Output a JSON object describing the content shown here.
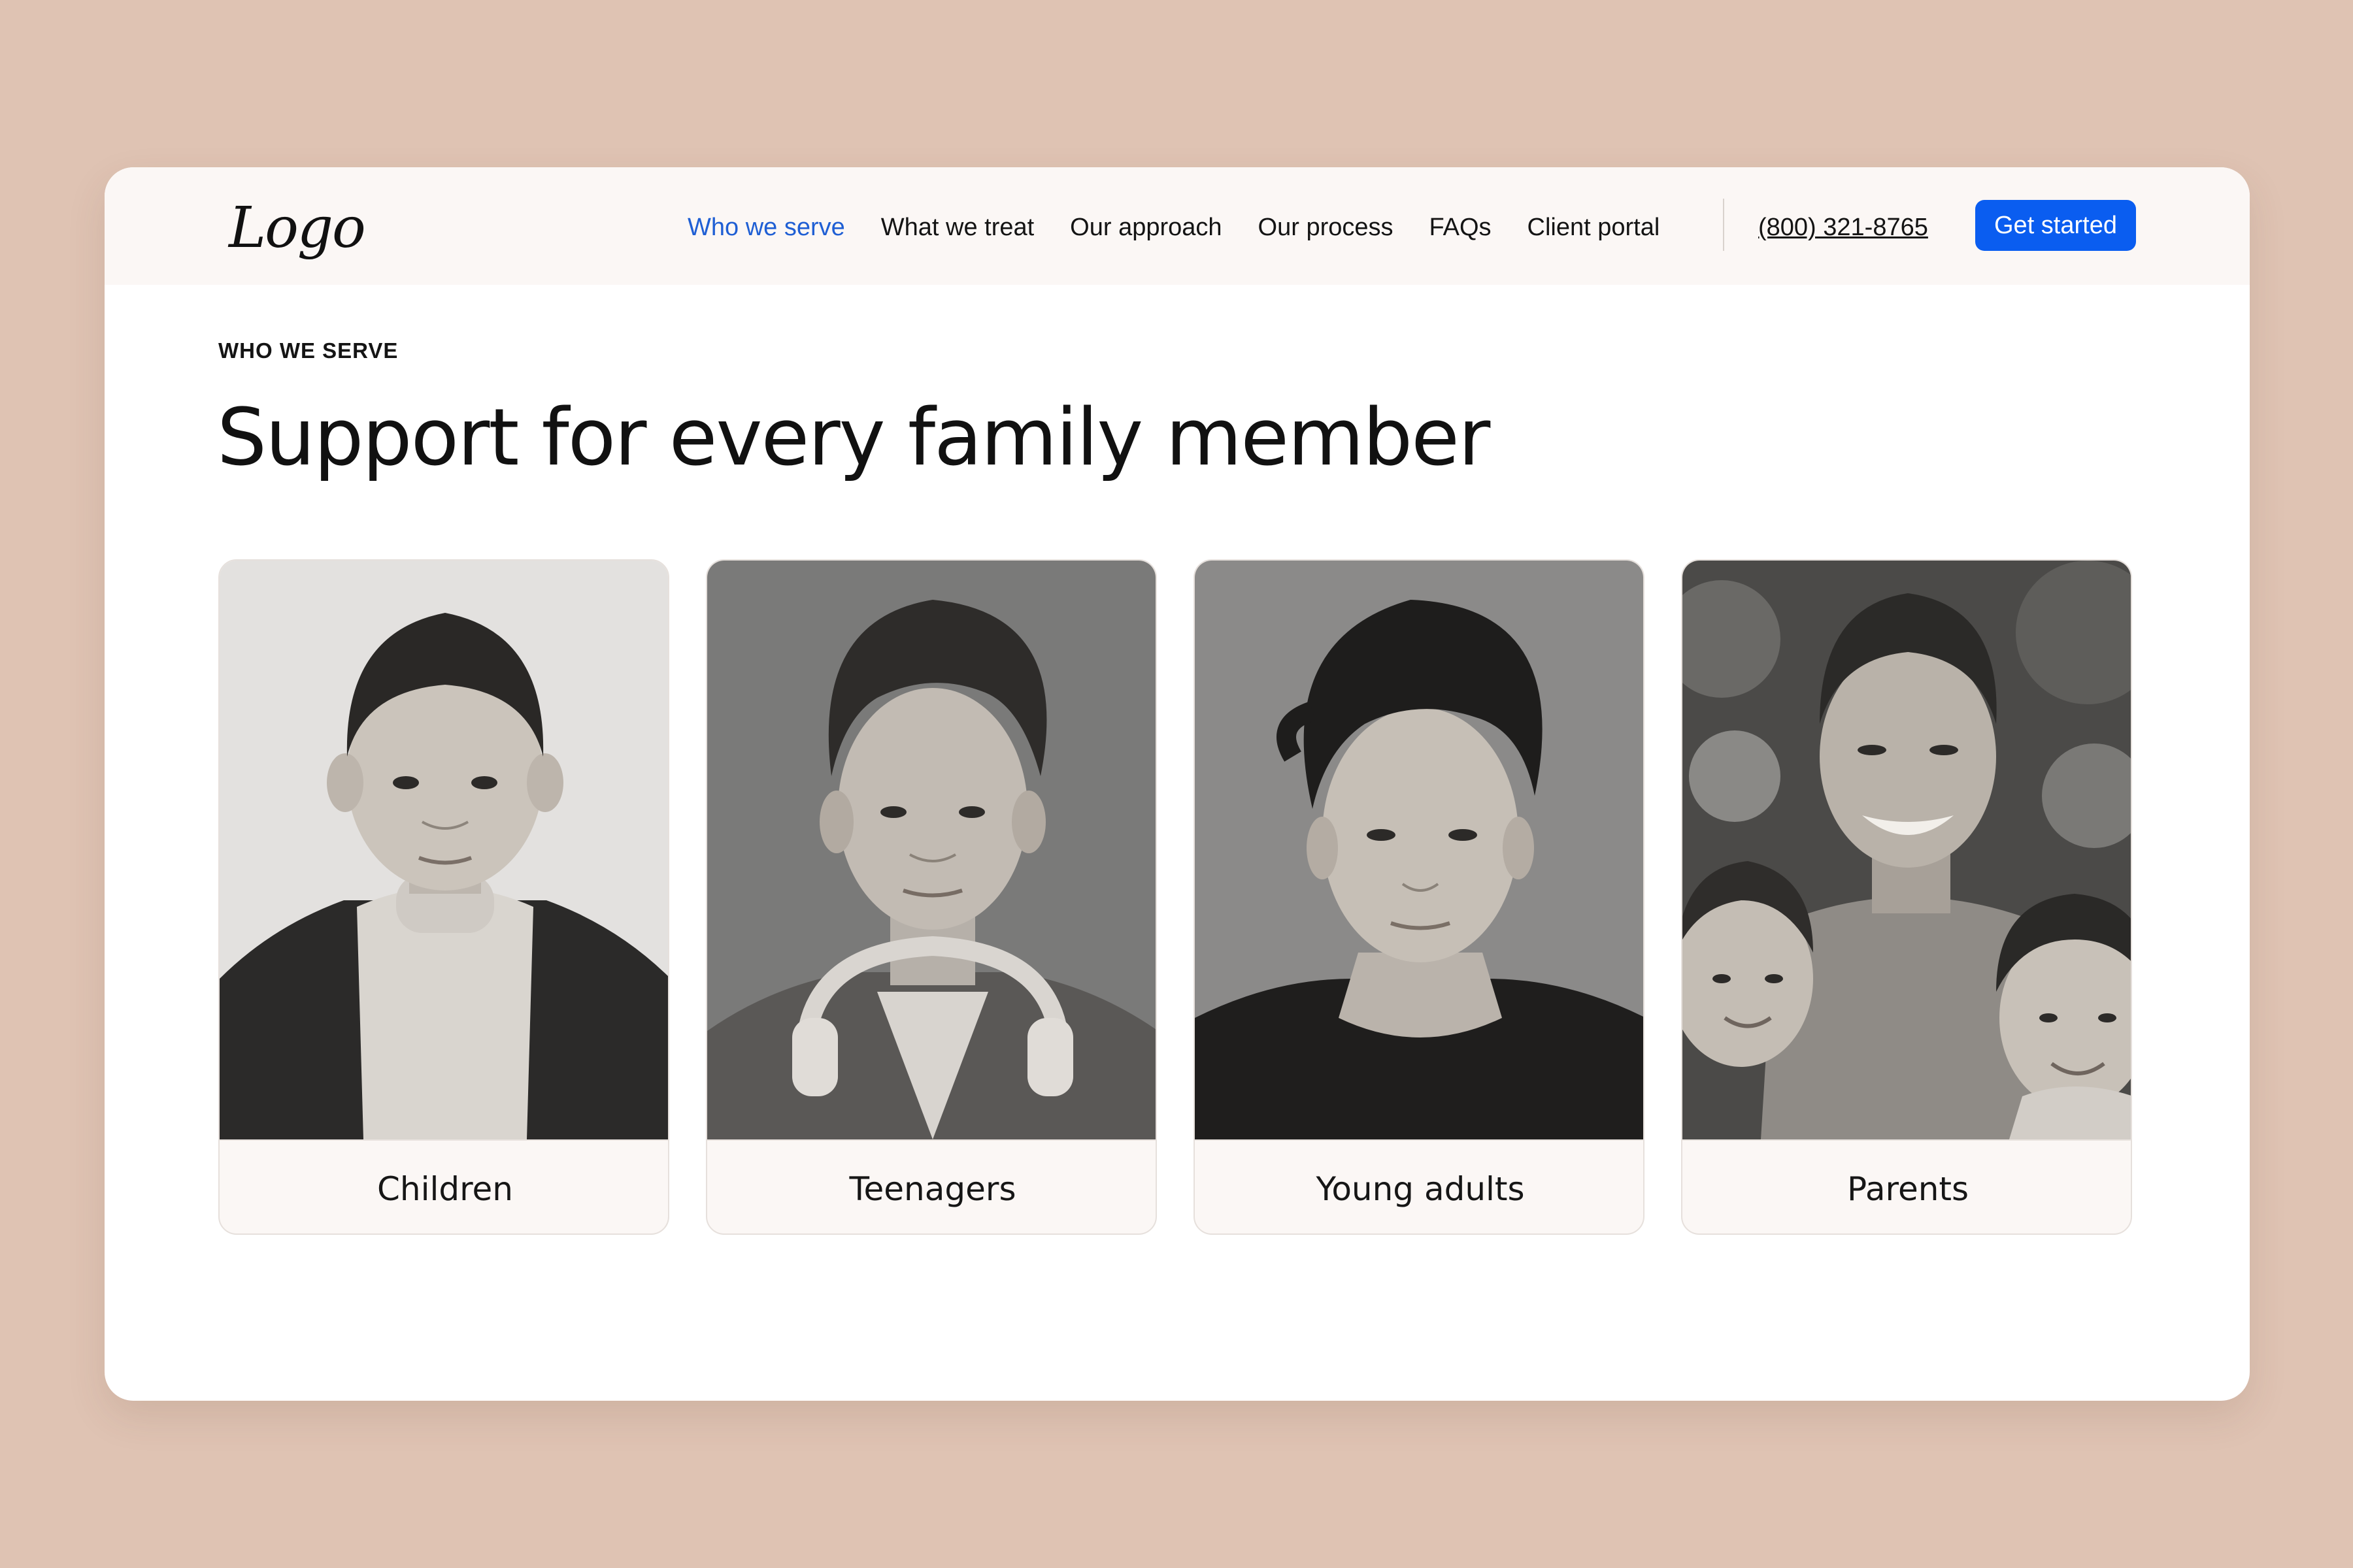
{
  "header": {
    "logo_text": "Logo",
    "nav": [
      {
        "label": "Who we serve",
        "active": true
      },
      {
        "label": "What we treat",
        "active": false
      },
      {
        "label": "Our approach",
        "active": false
      },
      {
        "label": "Our process",
        "active": false
      },
      {
        "label": "FAQs",
        "active": false
      },
      {
        "label": "Client portal",
        "active": false
      }
    ],
    "phone": "(800) 321-8765",
    "cta_label": "Get started"
  },
  "section": {
    "eyebrow": "WHO WE SERVE",
    "headline": "Support for every family member"
  },
  "cards": [
    {
      "label": "Children",
      "photo": "black-and-white portrait of a young boy in a turtleneck and corduroy jacket"
    },
    {
      "label": "Teenagers",
      "photo": "black-and-white portrait of a teenage boy with headphones around his neck"
    },
    {
      "label": "Young adults",
      "photo": "black-and-white portrait of a young man with wavy hair in a dark t-shirt"
    },
    {
      "label": "Parents",
      "photo": "black-and-white photo of a smiling father with two young children"
    }
  ],
  "colors": {
    "background": "#dfc3b3",
    "header_background": "#fbf7f5",
    "accent": "#0a5df0",
    "active_nav": "#1f5fd4"
  }
}
